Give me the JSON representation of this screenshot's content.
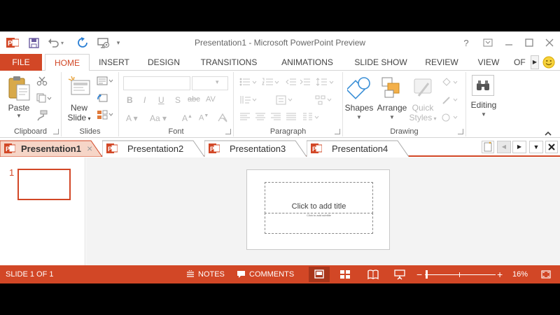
{
  "window": {
    "title": "Presentation1 - Microsoft PowerPoint Preview"
  },
  "qat": {
    "icons": [
      "powerpoint-logo-icon",
      "save-icon",
      "undo-icon",
      "redo-icon",
      "start-from-beginning-icon",
      "customize-qat-icon"
    ]
  },
  "title_controls": {
    "help": "?",
    "ribbon_display": "",
    "minimize": "",
    "maximize": "",
    "close": ""
  },
  "ribbon_tabs": {
    "file": "FILE",
    "home": "HOME",
    "insert": "INSERT",
    "design": "DESIGN",
    "transitions": "TRANSITIONS",
    "animations": "ANIMATIONS",
    "slide_show": "SLIDE SHOW",
    "review": "REVIEW",
    "view": "VIEW",
    "overflow": "OF"
  },
  "ribbon": {
    "clipboard": {
      "label": "Clipboard",
      "paste": "Paste"
    },
    "slides": {
      "label": "Slides",
      "new_slide_1": "New",
      "new_slide_2": "Slide"
    },
    "font": {
      "label": "Font",
      "font_name": "",
      "font_size": ""
    },
    "paragraph": {
      "label": "Paragraph"
    },
    "drawing": {
      "label": "Drawing",
      "shapes": "Shapes",
      "arrange": "Arrange",
      "quick_1": "Quick",
      "quick_2": "Styles"
    },
    "editing": {
      "label": "Editing"
    }
  },
  "doc_tabs": [
    {
      "label": "Presentation1",
      "active": true,
      "close": "×"
    },
    {
      "label": "Presentation2",
      "active": false
    },
    {
      "label": "Presentation3",
      "active": false
    },
    {
      "label": "Presentation4",
      "active": false
    }
  ],
  "thumbnails": [
    {
      "number": "1"
    }
  ],
  "slide": {
    "title_placeholder": "Click to add title",
    "subtitle_placeholder": "Click to add subtitle"
  },
  "status": {
    "slide_info": "SLIDE 1 OF 1",
    "notes": "NOTES",
    "comments": "COMMENTS",
    "zoom": "16%",
    "zoom_minus": "−",
    "zoom_plus": "+"
  },
  "colors": {
    "accent": "#d24726",
    "text": "#444444",
    "muted": "#b8b8b8"
  }
}
